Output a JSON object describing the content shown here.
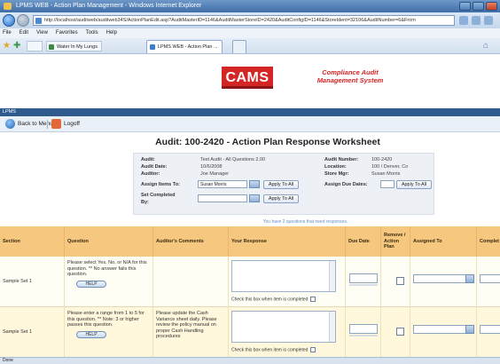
{
  "window": {
    "title": "LPMS WEB - Action Plan Management - Windows Internet Explorer",
    "url": "http://localhost/auditweb/auditweb34S/ActionPlanEdit.asp?AuditMasterID=1146&AuditMasterStoreID=2420&AuditConfigID=1146&StoreIdent=32106&AuditNumber=6&From",
    "menu": [
      "File",
      "Edit",
      "View",
      "Favorites",
      "Tools",
      "Help"
    ],
    "favorite_label": "Water In My Lungs",
    "tab_label": "LPMS WEB - Action Plan ...",
    "status_text": "Done"
  },
  "header": {
    "logo": "CAMS",
    "tagline": "Compliance Audit Management System",
    "section": "LPMS",
    "back_label": "Back to Menu",
    "logoff_label": "Logoff"
  },
  "page_title": "Audit: 100-2420 - Action Plan Response Worksheet",
  "info": {
    "audit_label": "Audit:",
    "audit_value": "Test Audit - All Questions 2.00",
    "audit_date_label": "Audit Date:",
    "audit_date_value": "10/6/2008",
    "auditor_label": "Auditor:",
    "auditor_value": "Joe Manager",
    "audit_number_label": "Audit Number:",
    "audit_number_value": "100-2420",
    "location_label": "Location:",
    "location_value": "100 / Denver, Co",
    "store_mgr_label": "Store Mgr:",
    "store_mgr_value": "Susan Morris",
    "assign_items_label": "Assign Items To:",
    "assign_items_value": "Susan Morris",
    "apply_label": "Apply To All",
    "assign_due_label": "Assign Due Dates:",
    "set_completed_label": "Set Completed",
    "set_completed_by": "By:"
  },
  "notice": "You have 2 questions that need responses.",
  "table": {
    "headers": {
      "section": "Section",
      "question": "Question",
      "comments": "Auditor's Comments",
      "response": "Your Response",
      "due": "Due Date",
      "remove": "Remove / Action Plan",
      "assigned": "Assigned To",
      "completed": "Complet"
    },
    "rows": [
      {
        "section": "Sample Set 1",
        "question": "Please select Yes, No, or N/A for this question. ** No answer fails this question.",
        "comments": "",
        "help": "HELP",
        "completed_text": "Check this box when item is completed"
      },
      {
        "section": "Sample Set 1",
        "question": "Please enter a range from 1 to 5 for this question. ** Note: 3 or higher passes this question.",
        "comments": "Please update the Cash Variance sheet daily. Please review the policy manual on proper Cash Handling procedures",
        "help": "HELP",
        "completed_text": "Check this box when item is completed"
      }
    ]
  }
}
